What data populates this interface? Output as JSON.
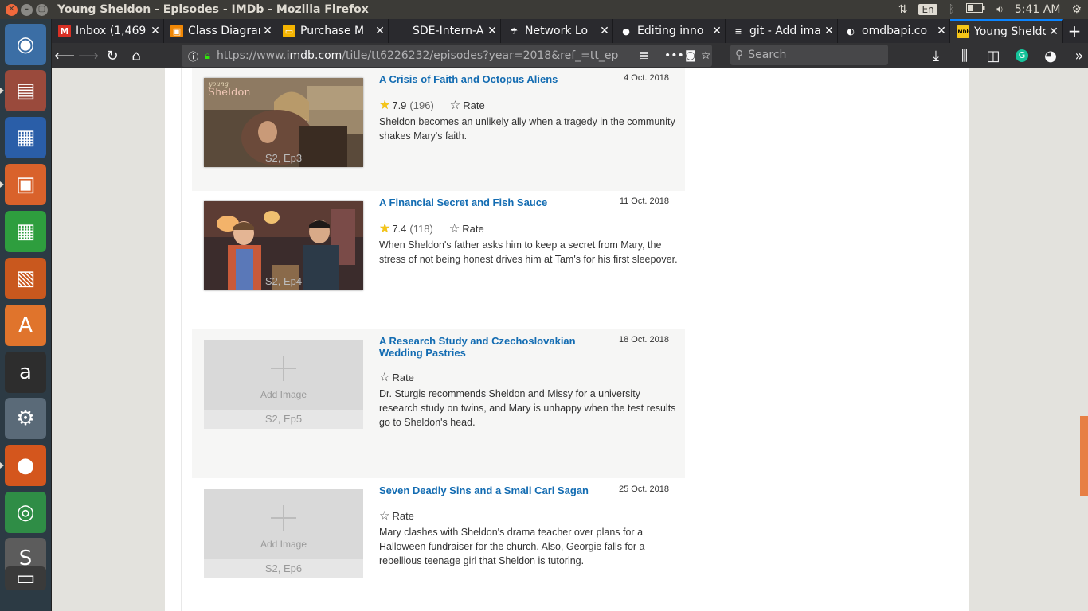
{
  "system": {
    "window_title": "Young Sheldon - Episodes - IMDb - Mozilla Firefox",
    "language": "En",
    "clock": "5:41 AM"
  },
  "launcher": {
    "items": [
      {
        "name": "ubuntu-dash",
        "icon": "ubuntu-logo-icon",
        "glyph": "◉",
        "color": "#3b6ea5"
      },
      {
        "name": "files",
        "icon": "file-cabinet-icon",
        "glyph": "▤",
        "color": "#9a4a3c"
      },
      {
        "name": "writer",
        "icon": "writer-document-icon",
        "glyph": "▦",
        "color": "#2a5ea8"
      },
      {
        "name": "file-manager",
        "icon": "folder-icon",
        "glyph": "▣",
        "color": "#d9622b"
      },
      {
        "name": "calc",
        "icon": "spreadsheet-icon",
        "glyph": "▦",
        "color": "#2e9e3e"
      },
      {
        "name": "impress",
        "icon": "presentation-icon",
        "glyph": "▧",
        "color": "#c9581e"
      },
      {
        "name": "software",
        "icon": "shopping-bag-icon",
        "glyph": "A",
        "color": "#e0742c"
      },
      {
        "name": "amazon",
        "icon": "amazon-icon",
        "glyph": "a",
        "color": "#2d2d2d"
      },
      {
        "name": "settings",
        "icon": "settings-wrench-icon",
        "glyph": "⚙",
        "color": "#5a6a78"
      },
      {
        "name": "firefox",
        "icon": "firefox-icon",
        "glyph": "●",
        "color": "#d4561d"
      },
      {
        "name": "chrome",
        "icon": "chrome-icon",
        "glyph": "◎",
        "color": "#2f8d46"
      },
      {
        "name": "sublime",
        "icon": "sublime-text-icon",
        "glyph": "S",
        "color": "#5c5c5c"
      },
      {
        "name": "terminal",
        "icon": "terminal-icon",
        "glyph": "▭",
        "color": "#3a3a3a"
      }
    ]
  },
  "browser": {
    "tabs": [
      {
        "label": "Inbox (1,469",
        "icon": "gmail-icon",
        "icon_color": "#d93025",
        "icon_glyph": "M",
        "active": false
      },
      {
        "label": "Class Diagram",
        "icon": "drawio-icon",
        "icon_color": "#f08705",
        "icon_glyph": "▣",
        "active": false
      },
      {
        "label": "Purchase M",
        "icon": "google-slides-icon",
        "icon_color": "#f4b400",
        "icon_glyph": "▭",
        "active": false
      },
      {
        "label": "SDE-Intern-Ass",
        "icon": "blank-page-icon",
        "icon_color": "#2a2a2e",
        "icon_glyph": "",
        "active": false
      },
      {
        "label": "Network Lo",
        "icon": "umbrella-icon",
        "icon_color": "#2a2a2e",
        "icon_glyph": "☂",
        "active": false
      },
      {
        "label": "Editing inno",
        "icon": "github-icon",
        "icon_color": "#2a2a2e",
        "icon_glyph": "●",
        "active": false
      },
      {
        "label": "git - Add ima",
        "icon": "stackoverflow-icon",
        "icon_color": "#2a2a2e",
        "icon_glyph": "≡",
        "active": false
      },
      {
        "label": "omdbapi.co",
        "icon": "omdb-icon",
        "icon_color": "#2a2a2e",
        "icon_glyph": "◐",
        "active": false
      },
      {
        "label": "Young Sheldo",
        "icon": "imdb-icon",
        "icon_color": "#f5c518",
        "icon_glyph": "IMDb",
        "active": true
      }
    ],
    "url": {
      "prefix": "https://www.",
      "host": "imdb.com",
      "path": "/title/tt6226232/episodes?year=2018&ref_=tt_ep"
    },
    "search_placeholder": "Search"
  },
  "episodes": [
    {
      "title": "A Crisis of Faith and Octopus Aliens",
      "date": "4 Oct. 2018",
      "rating": "7.9",
      "votes": "(196)",
      "rate_label": "Rate",
      "description": "Sheldon becomes an unlikely ally when a tragedy in the community shakes Mary's faith.",
      "episode_label": "S2, Ep3",
      "has_image": true,
      "thumb_overlay": "young Sheldon"
    },
    {
      "title": "A Financial Secret and Fish Sauce",
      "date": "11 Oct. 2018",
      "rating": "7.4",
      "votes": "(118)",
      "rate_label": "Rate",
      "description": "When Sheldon's father asks him to keep a secret from Mary, the stress of not being honest drives him at Tam's for his first sleepover.",
      "episode_label": "S2, Ep4",
      "has_image": true
    },
    {
      "title": "A Research Study and Czechoslovakian Wedding Pastries",
      "date": "18 Oct. 2018",
      "rate_label": "Rate",
      "description": "Dr. Sturgis recommends Sheldon and Missy for a university research study on twins, and Mary is unhappy when the test results go to Sheldon's head.",
      "episode_label": "S2, Ep5",
      "has_image": false,
      "add_image_label": "Add Image"
    },
    {
      "title": "Seven Deadly Sins and a Small Carl Sagan",
      "date": "25 Oct. 2018",
      "rate_label": "Rate",
      "description": "Mary clashes with Sheldon's drama teacher over plans for a Halloween fundraiser for the church. Also, Georgie falls for a rebellious teenage girl that Sheldon is tutoring.",
      "episode_label": "S2, Ep6",
      "has_image": false,
      "add_image_label": "Add Image"
    }
  ]
}
